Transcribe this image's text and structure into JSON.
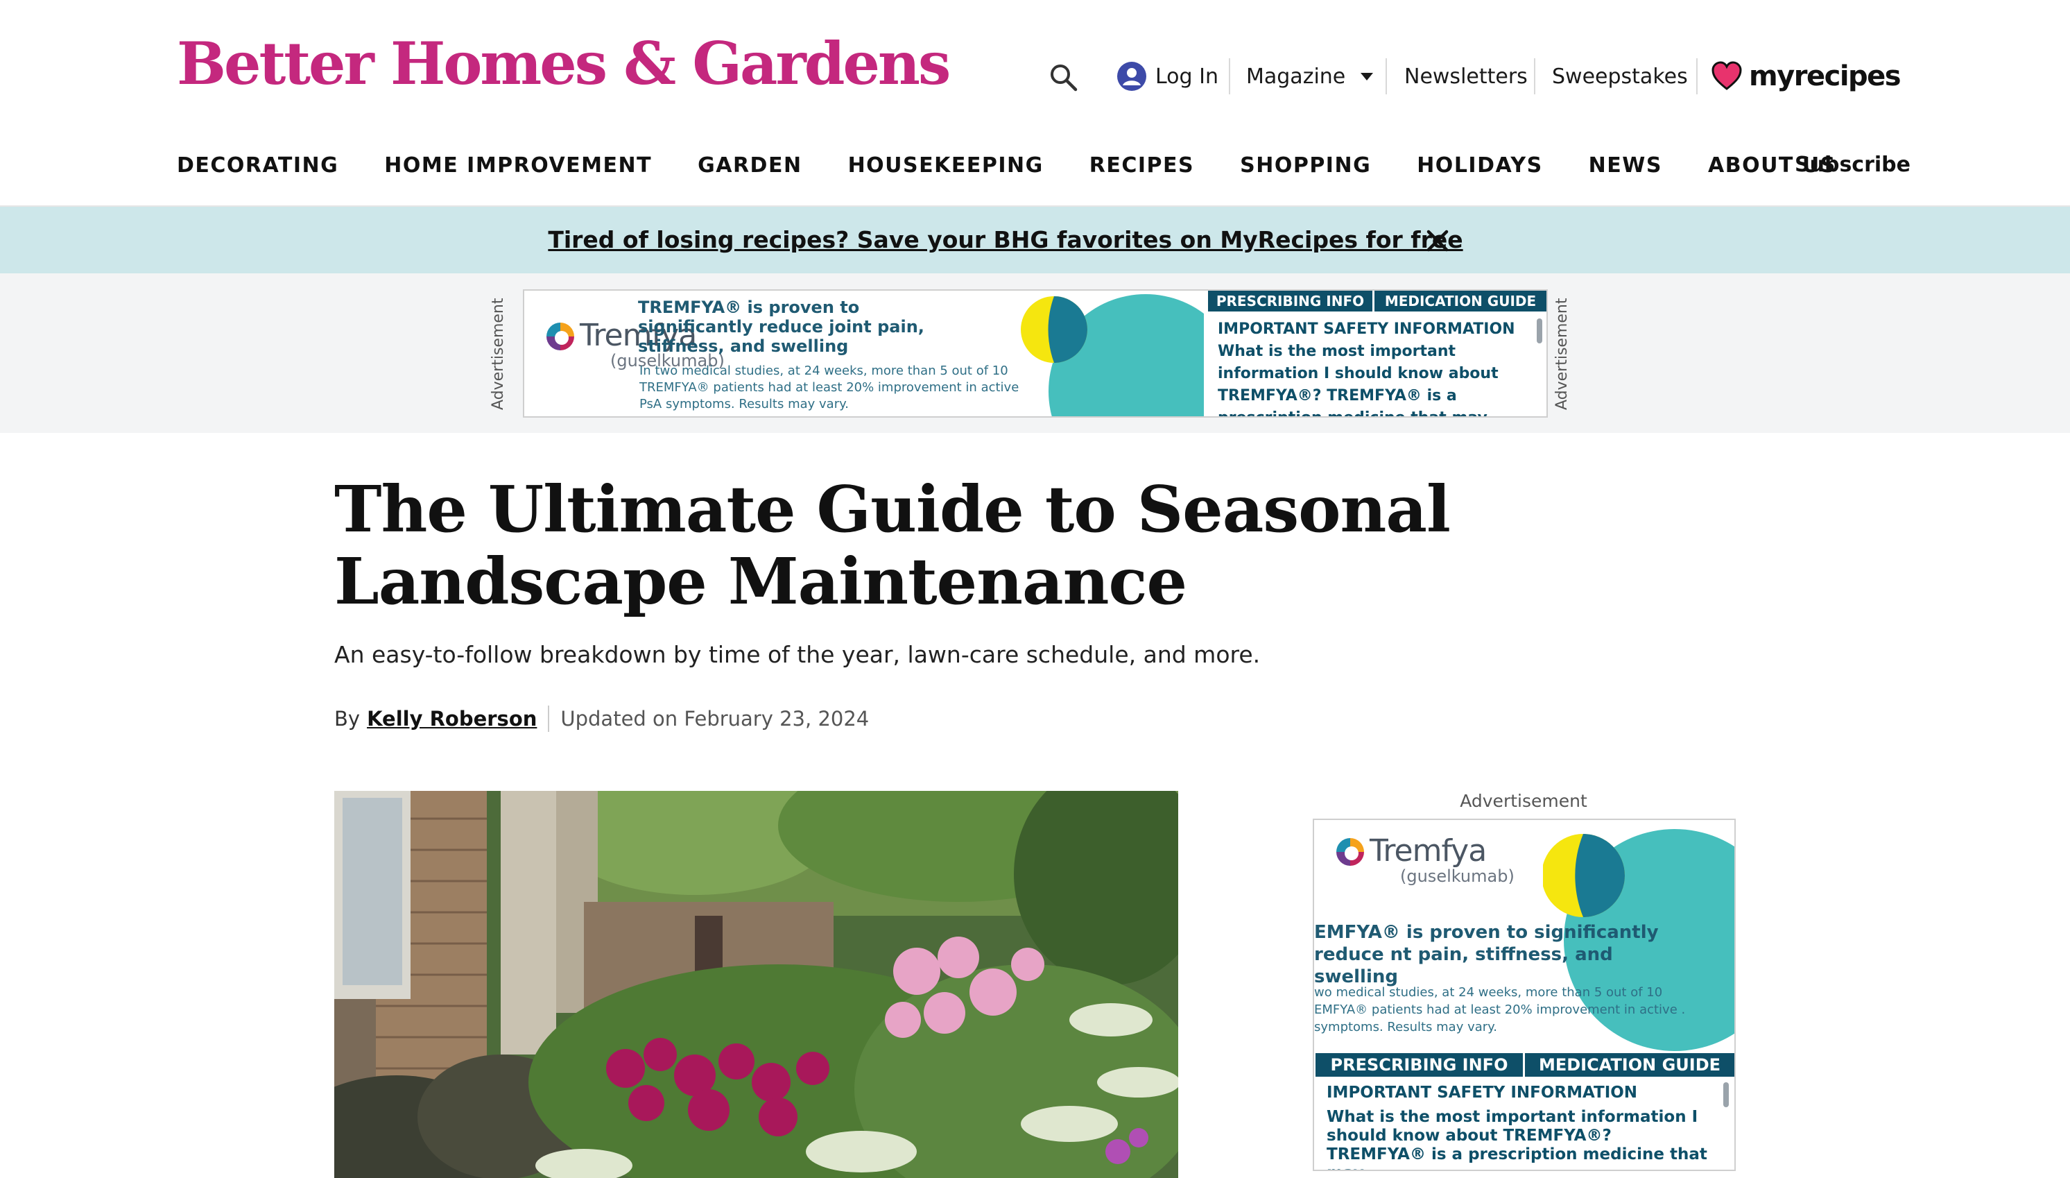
{
  "site": {
    "logo": "Better Homes & Gardens",
    "colors": {
      "brand": "#c4287e",
      "promo_bg": "#cde7ea",
      "ad_strip_bg": "#f3f4f5",
      "ad_teal": "#0e4f68"
    }
  },
  "utility": {
    "search_icon": "search-icon",
    "login_label": "Log In",
    "magazine_label": "Magazine",
    "newsletters_label": "Newsletters",
    "sweepstakes_label": "Sweepstakes",
    "partner_logo": "myrecipes"
  },
  "nav": {
    "items": [
      "DECORATING",
      "HOME IMPROVEMENT",
      "GARDEN",
      "HOUSEKEEPING",
      "RECIPES",
      "SHOPPING",
      "HOLIDAYS",
      "NEWS",
      "ABOUT US"
    ],
    "subscribe_label": "Subscribe"
  },
  "promo": {
    "text": "Tired of losing recipes? Save your BHG favorites on MyRecipes for free",
    "close_icon": "close-icon"
  },
  "top_ad": {
    "label": "Advertisement",
    "brand": "Tremfya",
    "brand_generic": "(guselkumab)",
    "headline": "TREMFYA® is proven to significantly reduce joint pain, stiffness, and swelling",
    "body": "In two medical studies, at 24 weeks, more than 5 out of 10 TREMFYA® patients had at least 20% improvement in active PsA symptoms. Results may vary.",
    "tab_prescribing": "PRESCRIBING INFO",
    "tab_guide": "MEDICATION GUIDE",
    "isi_heading": "IMPORTANT SAFETY INFORMATION",
    "isi_text": "What is the most important information I should know about TREMFYA®? TREMFYA® is a prescription medicine that may cause serious side effects"
  },
  "article": {
    "title": "The Ultimate Guide to Seasonal Landscape Maintenance",
    "dek": "An easy-to-follow breakdown by time of the year, lawn-care schedule, and more.",
    "by_prefix": "By",
    "author": "Kelly Roberson",
    "updated": "Updated on February 23, 2024"
  },
  "side_ad": {
    "label": "Advertisement",
    "brand": "Tremfya",
    "brand_generic": "(guselkumab)",
    "headline": "EMFYA® is proven to significantly reduce nt pain, stiffness, and swelling",
    "body": "wo medical studies, at 24 weeks, more than 5 out of 10 EMFYA® patients had at least 20% improvement in active . symptoms. Results may vary.",
    "tab_prescribing": "PRESCRIBING INFO",
    "tab_guide": "MEDICATION GUIDE",
    "isi_heading": "IMPORTANT SAFETY INFORMATION",
    "isi_text": "What is the most important information I should know about TREMFYA®? TREMFYA® is a prescription medicine that may"
  }
}
